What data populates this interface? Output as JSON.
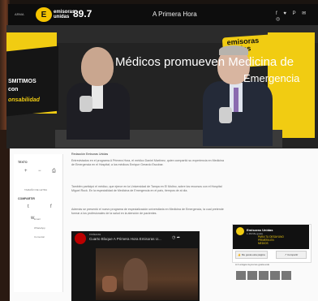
{
  "header": {
    "brand_small": "ARMA",
    "logo_glyph": "E",
    "brand_name_top": "emisoras",
    "brand_name_bottom": "unidas",
    "frequency": "89.7",
    "section_title": "A Primera Hora",
    "social_icons": "f ♥ P ✉ ◎"
  },
  "hero": {
    "left_banner_line1": "SMITIMOS",
    "left_banner_line2": "con",
    "left_banner_line3": "onsabilidad",
    "sign_line1": "emisoras",
    "sign_line2": "unidas",
    "headline": "Médicos promueven Medicina de",
    "headline_2": "Emergencia"
  },
  "sidebar": {
    "share_label": "TEXTO",
    "icons": [
      "+",
      "−",
      "⎙"
    ],
    "font_label": "TAMAÑO DE LETRA",
    "compartir_label": "COMPARTIR",
    "social_share": [
      "t",
      "f",
      "w"
    ],
    "links": [
      "Email",
      "WhatsApp",
      "Comentar"
    ]
  },
  "article": {
    "byline": "Redacción Emisoras Unidas",
    "p1": "Entrevistados en el programa A Primera Hora, el médico Daniel Martínez, quien compartió su experiencia en Medicina de Emergencia en el Hospital; a los médicos Enrique Gerardo Escobar.",
    "p2": "También participó el médico, que ejerce en la Universidad de Tampa en El Molino, sobre los recursos con el Hospital Miguel Rock. En la especialidad de Medicina de Emergencia en el país, tiempos de al día.",
    "p3": "Además se presentó el nuevo programa de especialización universitaria en Medicina de Emergencia, la cual pretende formar a los profesionales de la salud en la atención de pacientes."
  },
  "video": {
    "channel": "emisoras",
    "title": "Cuarto Bloque A Primera Hora Emisoras U...",
    "icons": "◷ ➦"
  },
  "widget": {
    "name": "Emisoras Unidas",
    "likes": "1.1M Me gusta",
    "promo_line1": "PARA TU DESAYUNO",
    "promo_line2": "PRIMERA EN",
    "promo_line3": "MEDIOS",
    "btn_like": "👍 Me gusta esta página",
    "btn_share": "↗ Compartir",
    "caption": "A 4 amigos tuyos les gusta esto"
  },
  "colors": {
    "brand_yellow": "#f1cc12",
    "topbar": "#0d0d0d"
  }
}
